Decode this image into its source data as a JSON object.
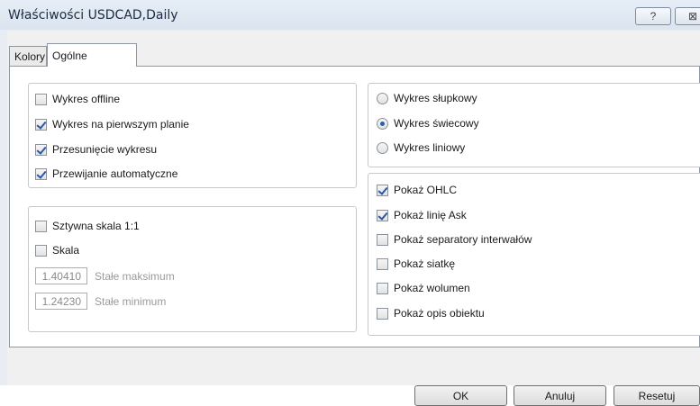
{
  "window": {
    "title": "Właściwości USDCAD,Daily",
    "help_symbol": "?",
    "close_symbol": "⊠"
  },
  "tabs": [
    {
      "label": "Kolory",
      "active": false
    },
    {
      "label": "Ogólne",
      "active": true
    }
  ],
  "left_group_1": [
    {
      "label": "Wykres offline",
      "checked": false
    },
    {
      "label": "Wykres na pierwszym planie",
      "checked": true
    },
    {
      "label": "Przesunięcie wykresu",
      "checked": true
    },
    {
      "label": "Przewijanie automatyczne",
      "checked": true
    }
  ],
  "left_group_2": {
    "fixed_scale": {
      "label": "Sztywna skala 1:1",
      "checked": false
    },
    "scale": {
      "label": "Skala",
      "checked": false
    },
    "max": {
      "value": "1.40410",
      "label": "Stałe maksimum"
    },
    "min": {
      "value": "1.24230",
      "label": "Stałe minimum"
    }
  },
  "chart_type": [
    {
      "label": "Wykres słupkowy",
      "selected": false
    },
    {
      "label": "Wykres świecowy",
      "selected": true
    },
    {
      "label": "Wykres liniowy",
      "selected": false
    }
  ],
  "show_options": [
    {
      "label": "Pokaż OHLC",
      "checked": true
    },
    {
      "label": "Pokaż linię Ask",
      "checked": true
    },
    {
      "label": "Pokaż separatory interwałów",
      "checked": false
    },
    {
      "label": "Pokaż siatkę",
      "checked": false
    },
    {
      "label": "Pokaż wolumen",
      "checked": false
    },
    {
      "label": "Pokaż opis obiektu",
      "checked": false
    }
  ],
  "buttons": {
    "ok": "OK",
    "cancel": "Anuluj",
    "reset": "Resetuj"
  }
}
